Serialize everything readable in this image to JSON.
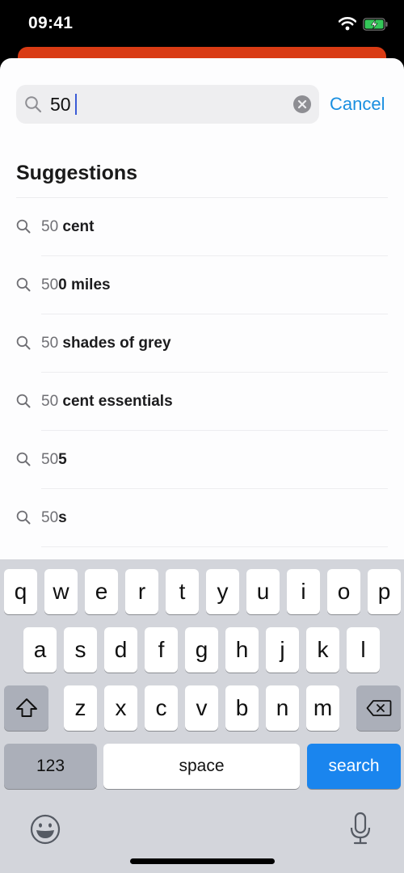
{
  "status_bar": {
    "time": "09:41",
    "battery_charging": true,
    "battery_color": "#34c759"
  },
  "accent_color": "#1a8fe0",
  "behind_card_color": "#d93b14",
  "search": {
    "query": "50",
    "cancel_label": "Cancel"
  },
  "suggestions": {
    "title": "Suggestions",
    "items": [
      {
        "query_part": "50",
        "rest": " cent"
      },
      {
        "query_part": "50",
        "rest": "0 miles"
      },
      {
        "query_part": "50",
        "rest": " shades of grey"
      },
      {
        "query_part": "50",
        "rest": " cent essentials"
      },
      {
        "query_part": "50",
        "rest": "5"
      },
      {
        "query_part": "50",
        "rest": "s"
      }
    ]
  },
  "keyboard": {
    "row1": [
      "q",
      "w",
      "e",
      "r",
      "t",
      "y",
      "u",
      "i",
      "o",
      "p"
    ],
    "row2": [
      "a",
      "s",
      "d",
      "f",
      "g",
      "h",
      "j",
      "k",
      "l"
    ],
    "row3": [
      "z",
      "x",
      "c",
      "v",
      "b",
      "n",
      "m"
    ],
    "numbers_label": "123",
    "space_label": "space",
    "return_label": "search"
  }
}
